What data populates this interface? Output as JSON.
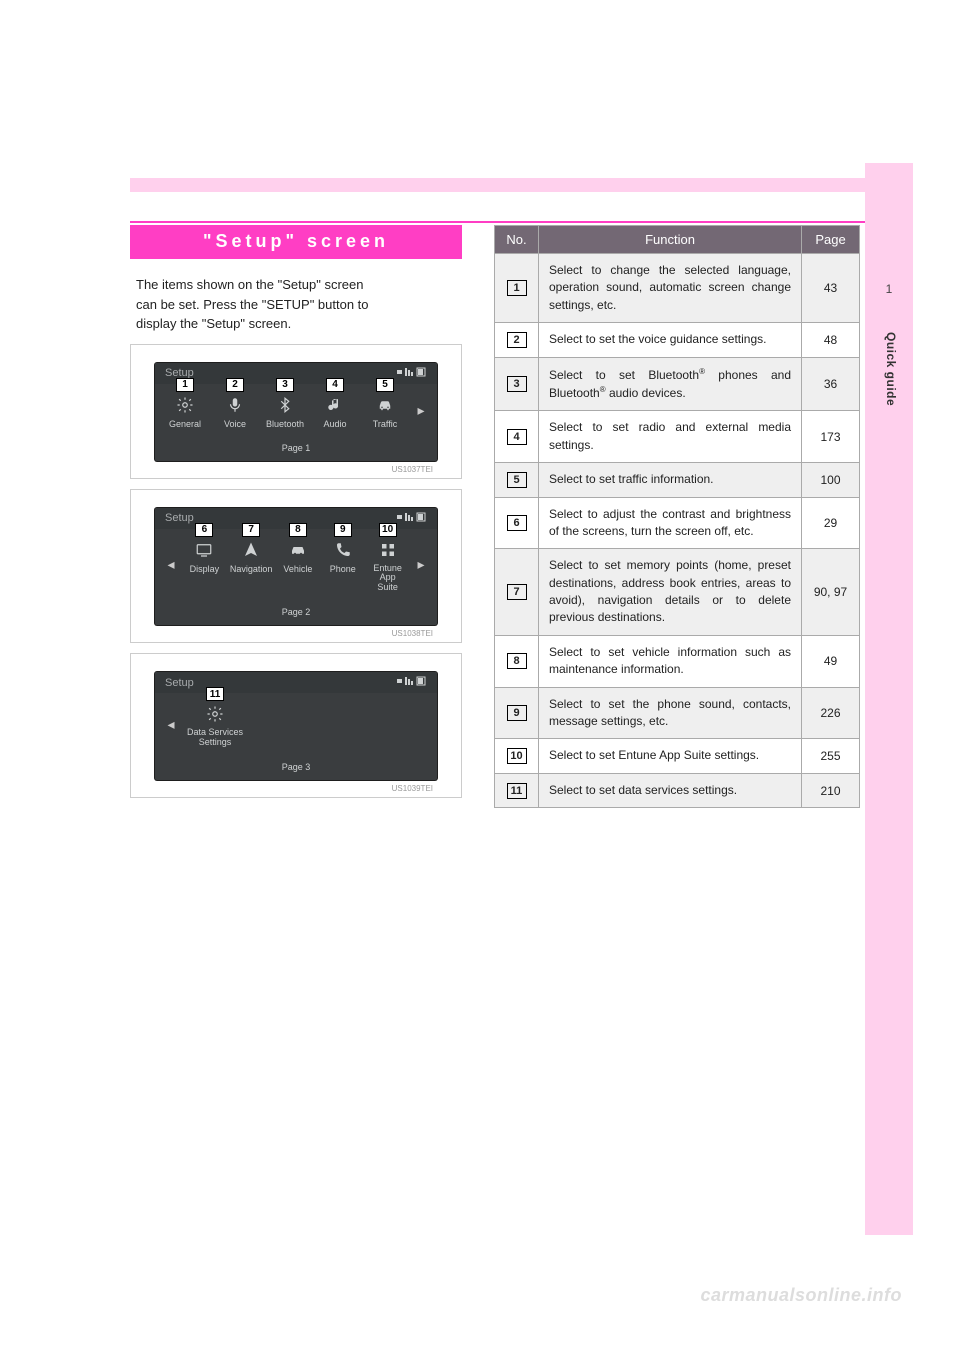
{
  "section_tab": {
    "number": "1",
    "label": "Quick guide"
  },
  "heading": "\"Setup\" screen",
  "intro_line1": "The items shown on the \"Setup\" screen",
  "intro_line2": "can be set. Press the \"SETUP\" button to",
  "intro_line3": "display the \"Setup\" screen.",
  "screens": [
    {
      "title": "Setup",
      "page_label": "Page 1",
      "image_code": "US1037TEI",
      "items": [
        {
          "callout": "1",
          "label": "General",
          "icon": "gear"
        },
        {
          "callout": "2",
          "label": "Voice",
          "icon": "mic"
        },
        {
          "callout": "3",
          "label": "Bluetooth",
          "icon": "bluetooth"
        },
        {
          "callout": "4",
          "label": "Audio",
          "icon": "note"
        },
        {
          "callout": "5",
          "label": "Traffic",
          "icon": "car"
        }
      ],
      "left_arrow": false,
      "right_arrow": true
    },
    {
      "title": "Setup",
      "page_label": "Page 2",
      "image_code": "US1038TEI",
      "items": [
        {
          "callout": "6",
          "label": "Display",
          "icon": "display"
        },
        {
          "callout": "7",
          "label": "Navigation",
          "icon": "navigation"
        },
        {
          "callout": "8",
          "label": "Vehicle",
          "icon": "vehicle"
        },
        {
          "callout": "9",
          "label": "Phone",
          "icon": "phone"
        },
        {
          "callout": "10",
          "label": "Entune\nApp Suite",
          "icon": "apps"
        }
      ],
      "left_arrow": true,
      "right_arrow": true
    },
    {
      "title": "Setup",
      "page_label": "Page 3",
      "image_code": "US1039TEI",
      "items": [
        {
          "callout": "11",
          "label": "Data Services\nSettings",
          "icon": "gear"
        }
      ],
      "left_arrow": true,
      "right_arrow": false
    }
  ],
  "table": {
    "headers": {
      "no": "No.",
      "fn": "Function",
      "page": "Page"
    },
    "rows": [
      {
        "no": "1",
        "fn": "Select to change the selected language, operation sound, automatic screen change settings, etc.",
        "page": "43"
      },
      {
        "no": "2",
        "fn": "Select to set the voice guidance settings.",
        "page": "48"
      },
      {
        "no": "3",
        "fn": "Select to set Bluetooth® phones and Bluetooth® audio devices.",
        "page": "36"
      },
      {
        "no": "4",
        "fn": "Select to set radio and external media settings.",
        "page": "173"
      },
      {
        "no": "5",
        "fn": "Select to set traffic information.",
        "page": "100"
      },
      {
        "no": "6",
        "fn": "Select to adjust the contrast and brightness of the screens, turn the screen off, etc.",
        "page": "29"
      },
      {
        "no": "7",
        "fn": "Select to set memory points (home, preset destinations, address book entries, areas to avoid), navigation details or to delete previous destinations.",
        "page": "90, 97"
      },
      {
        "no": "8",
        "fn": "Select to set vehicle information such as maintenance information.",
        "page": "49"
      },
      {
        "no": "9",
        "fn": "Select to set the phone sound, contacts, message settings, etc.",
        "page": "226"
      },
      {
        "no": "10",
        "fn": "Select to set Entune App Suite settings.",
        "page": "255"
      },
      {
        "no": "11",
        "fn": "Select to set data services settings.",
        "page": "210"
      }
    ]
  },
  "watermark": "carmanualsonline.info"
}
